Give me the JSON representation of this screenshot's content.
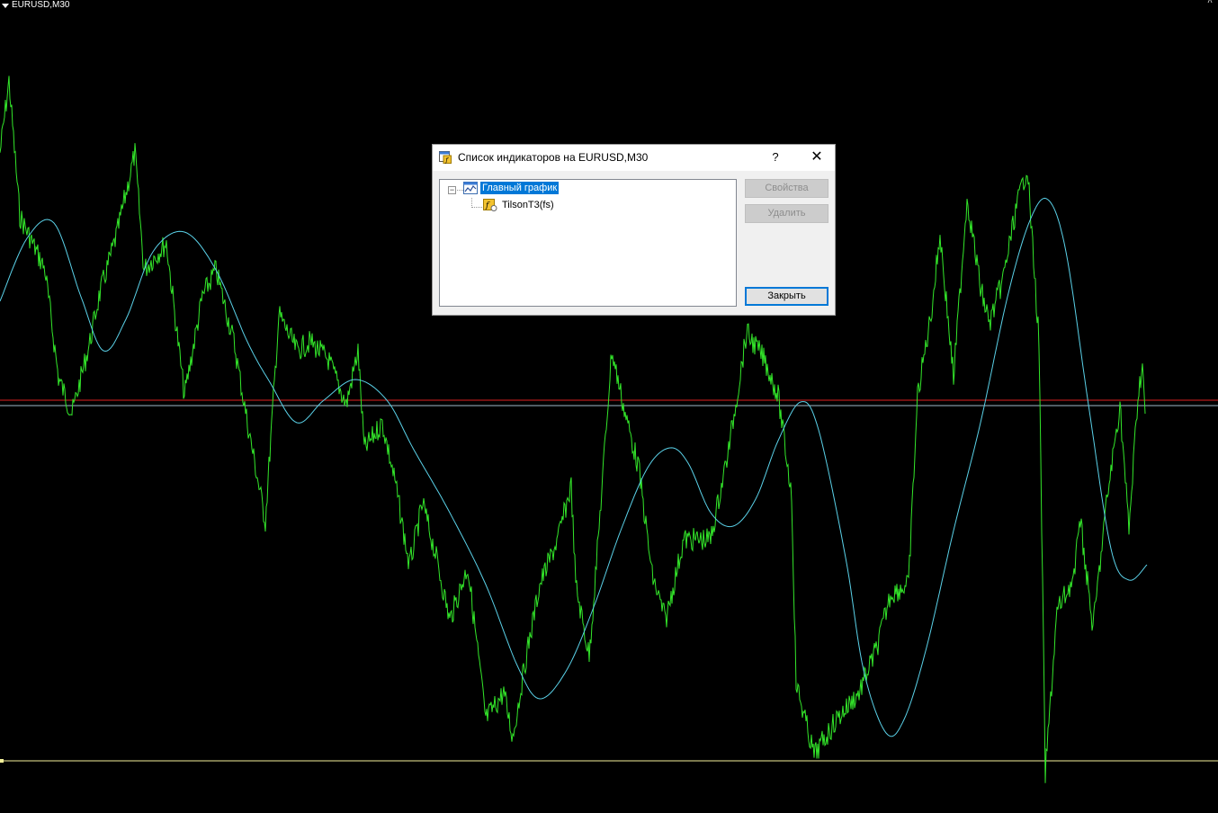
{
  "chart": {
    "symbol_label": "EURUSD,M30",
    "colors": {
      "background": "#000000",
      "price_line": "#33e62a",
      "t3_line": "#5ad1e8",
      "bid_line": "#e02020",
      "ask_line": "#9fb9c8",
      "level_line": "#f3f09a"
    }
  },
  "dialog": {
    "title": "Список индикаторов на EURUSD,M30",
    "help_label": "?",
    "close_glyph": "✕",
    "tree": {
      "root_label": "Главный график",
      "root_icon": "chart-window-icon",
      "children": [
        {
          "label": "TilsonT3(fs)",
          "icon": "custom-indicator-icon"
        }
      ]
    },
    "buttons": {
      "properties": "Свойства",
      "delete": "Удалить",
      "close": "Закрыть"
    }
  }
}
